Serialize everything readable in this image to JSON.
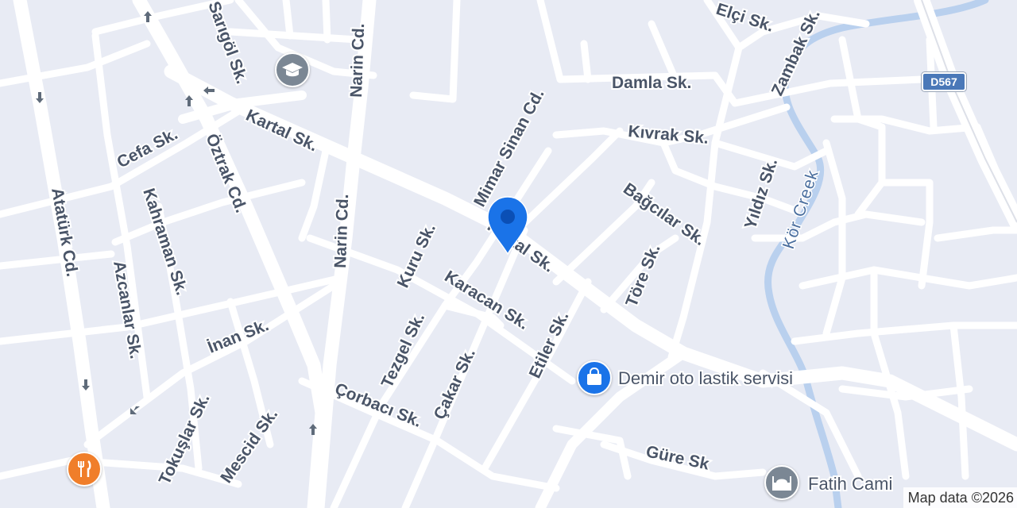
{
  "map": {
    "route_shield": "D567",
    "attribution": "Map data ©2026",
    "streets": [
      "Elçi Sk.",
      "Zambak Sk.",
      "Sarıgöl Sk.",
      "Narin Cd.",
      "Damla Sk.",
      "Mimar Sinan Cd.",
      "Kartal Sk.",
      "Cefa Sk.",
      "Kıvrak Sk.",
      "Öztrak Cd.",
      "Kahraman Sk.",
      "Atatürk Cd.",
      "Bağcılar Sk.",
      "Yıldız Sk.",
      "Narin Cd.",
      "Kuru Sk.",
      "Kartal Sk.",
      "Azcanlar Sk.",
      "Töre Sk.",
      "Karacan Sk.",
      "İnan Sk.",
      "Tezgel Sk.",
      "Çakar Sk.",
      "Etiler Sk.",
      "Tokuşlar Sk.",
      "Çorbacı Sk.",
      "Mescid Sk.",
      "Güre Sk"
    ],
    "water_label": "Kör Creek",
    "pois": [
      {
        "name": "Demir oto lastik servisi",
        "icon": "shopping-bag-icon",
        "color": "#1a73e8"
      },
      {
        "name": "Fatih Cami",
        "icon": "mosque-icon",
        "color": "#7b8794"
      },
      {
        "name": "",
        "icon": "restaurant-icon",
        "color": "#f07e2a"
      },
      {
        "name": "",
        "icon": "school-icon",
        "color": "#7b8794"
      }
    ],
    "location_pin": {
      "icon": "location-pin-icon",
      "color": "#1a73e8"
    }
  }
}
